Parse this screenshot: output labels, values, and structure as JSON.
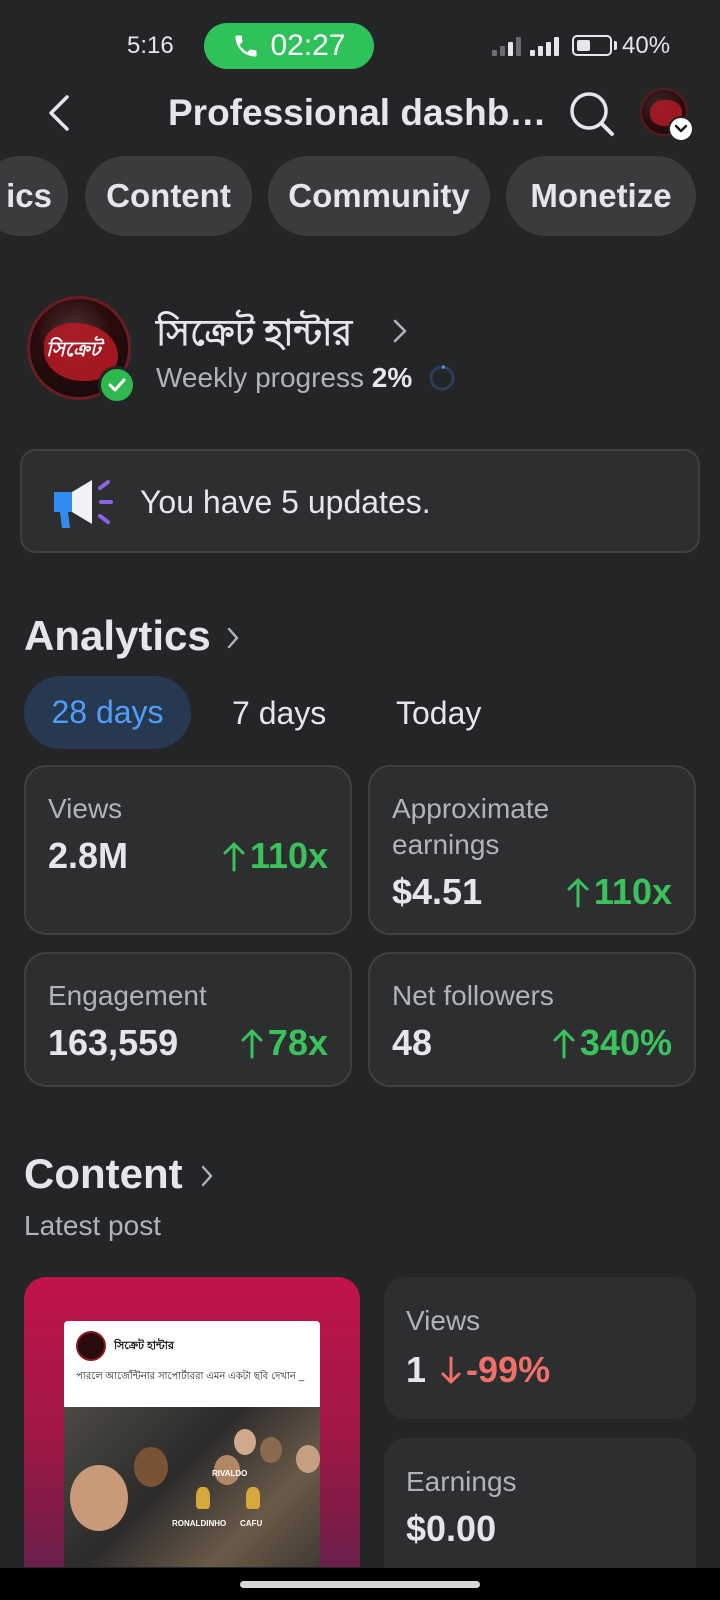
{
  "status_bar": {
    "time": "5:16",
    "call_timer": "02:27",
    "battery": "40%"
  },
  "header": {
    "title": "Professional dashb…"
  },
  "tabs": [
    {
      "label": "ics"
    },
    {
      "label": "Content"
    },
    {
      "label": "Community"
    },
    {
      "label": "Monetize"
    }
  ],
  "profile": {
    "name": "সিক্রেট হান্টার",
    "progress_label": "Weekly progress",
    "progress_value": "2%",
    "progress_fraction": 0.02,
    "avatar_logo_text": "সিক্রেট হান্টার"
  },
  "updates": {
    "text": "You have 5 updates."
  },
  "analytics": {
    "title": "Analytics",
    "periods": [
      "28 days",
      "7 days",
      "Today"
    ],
    "selected_period": "28 days",
    "stats": [
      {
        "label": "Views",
        "value": "2.8M",
        "change": "110x",
        "direction": "up"
      },
      {
        "label": "Approximate earnings",
        "value": "$4.51",
        "change": "110x",
        "direction": "up"
      },
      {
        "label": "Engagement",
        "value": "163,559",
        "change": "78x",
        "direction": "up"
      },
      {
        "label": "Net followers",
        "value": "48",
        "change": "340%",
        "direction": "up"
      }
    ]
  },
  "content": {
    "title": "Content",
    "subtitle": "Latest post",
    "post": {
      "author": "সিক্রেট হান্টার",
      "caption": "পারলে আর্জেন্টিনার সাপোর্টাররা এমন একটা ছবি দেখান _",
      "photo_captions": [
        "RONALDINHO",
        "CAFU",
        "RIVALDO"
      ]
    },
    "post_views": {
      "label": "Views",
      "value": "1",
      "change": "-99%",
      "direction": "down"
    },
    "post_earnings": {
      "label": "Earnings",
      "value": "$0.00"
    }
  },
  "colors": {
    "background": "#242526",
    "card": "#2d2e2f",
    "accent_blue": "#4f9ef8",
    "positive": "#3cc25c",
    "negative": "#f0706a",
    "call_green": "#2fc25b"
  },
  "icons": [
    "phone-icon",
    "signal-icon",
    "battery-icon",
    "back-arrow-icon",
    "search-icon",
    "chevron-down-icon",
    "chevron-right-icon",
    "verified-check-icon",
    "progress-ring-icon",
    "megaphone-icon",
    "arrow-up-icon",
    "arrow-down-icon"
  ]
}
